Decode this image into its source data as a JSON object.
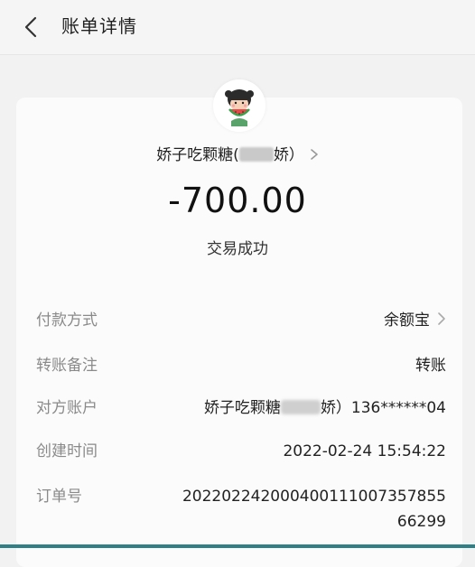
{
  "header": {
    "title": "账单详情",
    "back_icon": "chevron-left-icon"
  },
  "transaction": {
    "counterparty_prefix": "娇子吃颗糖(",
    "counterparty_suffix": "娇）",
    "amount": "-700.00",
    "status": "交易成功"
  },
  "details": {
    "payment_method": {
      "label": "付款方式",
      "value": "余额宝"
    },
    "note": {
      "label": "转账备注",
      "value": "转账"
    },
    "account": {
      "label": "对方账户",
      "value_prefix": "娇子吃颗糖",
      "value_suffix": "娇）136******04"
    },
    "created": {
      "label": "创建时间",
      "value": "2022-02-24 15:54:22"
    },
    "order": {
      "label": "订单号",
      "value": "20220224200040011100735785566299"
    }
  },
  "colors": {
    "background": "#f2f2f2",
    "card": "#fbfbfb",
    "label": "#8a8a8a",
    "text": "#222222"
  }
}
